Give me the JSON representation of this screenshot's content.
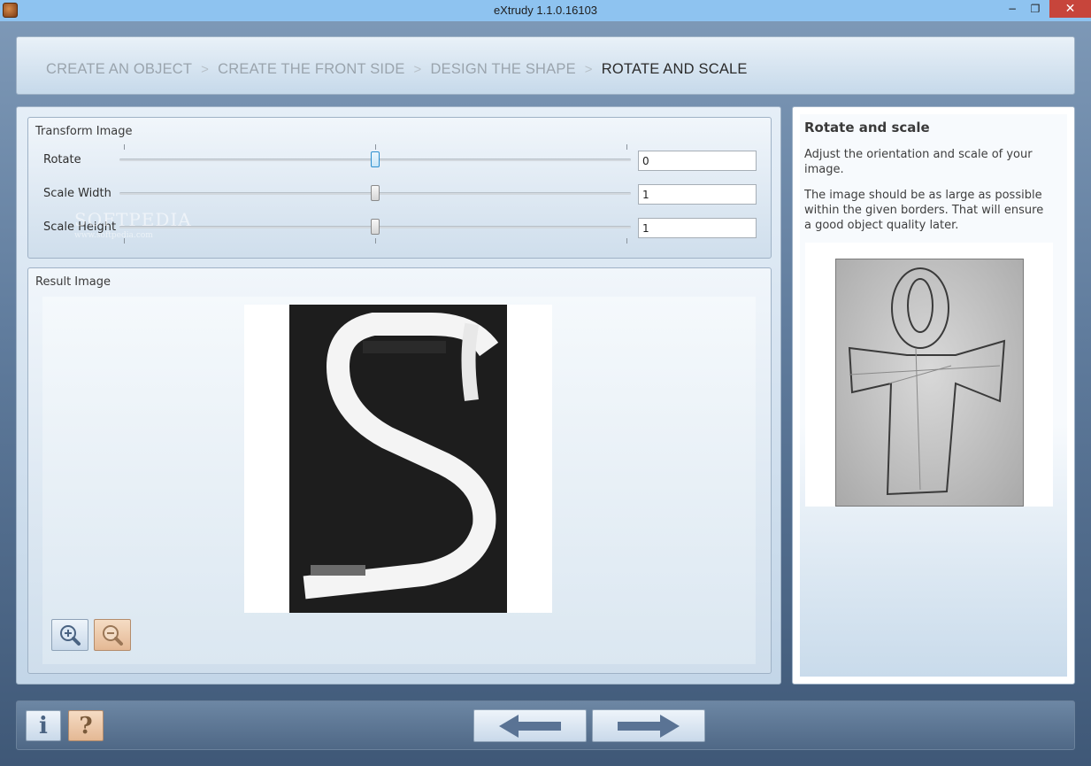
{
  "window": {
    "title": "eXtrudy 1.1.0.16103",
    "minimize_glyph": "−",
    "maximize_glyph": "❐",
    "close_glyph": "✕"
  },
  "breadcrumb": {
    "steps": [
      {
        "label": "CREATE AN OBJECT",
        "active": false
      },
      {
        "label": "CREATE THE FRONT SIDE",
        "active": false
      },
      {
        "label": "DESIGN THE SHAPE",
        "active": false
      },
      {
        "label": "ROTATE AND SCALE",
        "active": true
      }
    ],
    "separator": ">"
  },
  "transform": {
    "title": "Transform Image",
    "rows": [
      {
        "label": "Rotate",
        "value": "0",
        "slider_level": 0.5
      },
      {
        "label": "Scale Width",
        "value": "1",
        "slider_level": 0.5
      },
      {
        "label": "Scale Height",
        "value": "1",
        "slider_level": 0.5
      }
    ]
  },
  "watermark": {
    "text": "SOFTPEDIA",
    "sub": "www.softpedia.com"
  },
  "result": {
    "title": "Result Image",
    "zoom_in_icon": "zoom-in-icon",
    "zoom_out_icon": "zoom-out-icon"
  },
  "info": {
    "title": "Rotate and scale",
    "paragraph1": "Adjust the orientation and scale of your image.",
    "paragraph2": "The image should be as large as possible within the given borders. That will ensure a good object quality later."
  },
  "footer": {
    "info_glyph": "i",
    "help_glyph": "?",
    "back_icon": "arrow-left-icon",
    "next_icon": "arrow-right-icon"
  },
  "colors": {
    "titlebar": "#8ec3f0",
    "close": "#c7453b",
    "accent_blue": "#2c8fcf",
    "arrow": "#5a7394"
  }
}
